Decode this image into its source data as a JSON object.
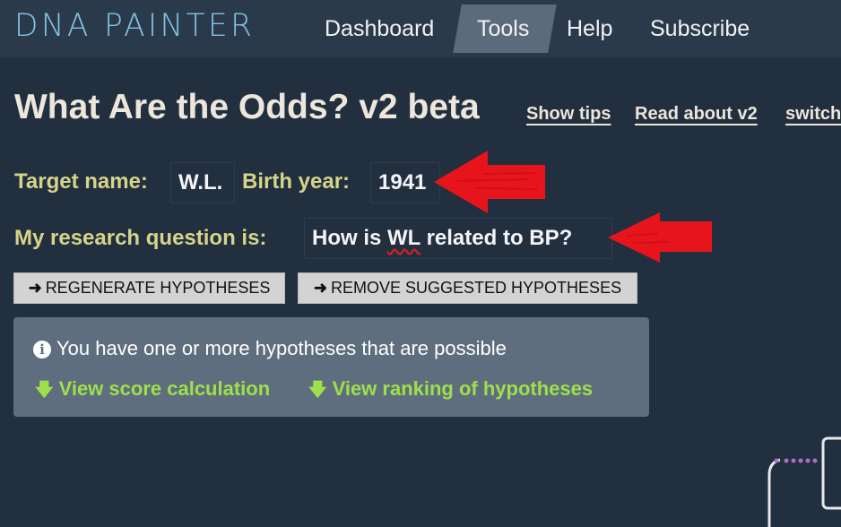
{
  "navbar": {
    "logo": "DNA PAINTER",
    "items": [
      {
        "label": "Dashboard",
        "active": false
      },
      {
        "label": "Tools",
        "active": true
      },
      {
        "label": "Help",
        "active": false
      },
      {
        "label": "Subscribe",
        "active": false
      }
    ]
  },
  "page": {
    "title": "What Are the Odds? v2 beta",
    "links": [
      {
        "label": "Show tips"
      },
      {
        "label": "Read about v2"
      },
      {
        "label": "switch"
      }
    ]
  },
  "form": {
    "target_name_label": "Target name:",
    "target_name_value": "W.L.",
    "birth_year_label": "Birth year:",
    "birth_year_value": "1941",
    "research_question_label": "My research question is:",
    "research_question_value_prefix": "How is ",
    "research_question_value_misspelled": "WL",
    "research_question_value_suffix": " related to BP?"
  },
  "buttons": {
    "regenerate": {
      "icon": "arrow-right-icon",
      "label": "REGENERATE HYPOTHESES"
    },
    "remove": {
      "icon": "arrow-right-icon",
      "label": "REMOVE SUGGESTED HYPOTHESES"
    }
  },
  "info_box": {
    "icon": "info-circle-icon",
    "message": "You have one or more hypotheses that are possible",
    "links": [
      {
        "icon": "arrow-down-icon",
        "label": "View score calculation"
      },
      {
        "icon": "arrow-down-icon",
        "label": "View ranking of hypotheses"
      }
    ]
  },
  "annotations": {
    "arrow_color": "#e8141c"
  },
  "colors": {
    "background": "#222f3f",
    "navbar": "#2b3a4b",
    "logo": "#82c3e8",
    "label": "#d6d48a",
    "link_green": "#9ee04a",
    "info_box": "#5e6e7e",
    "diagram_dots": "#b06cc8"
  }
}
